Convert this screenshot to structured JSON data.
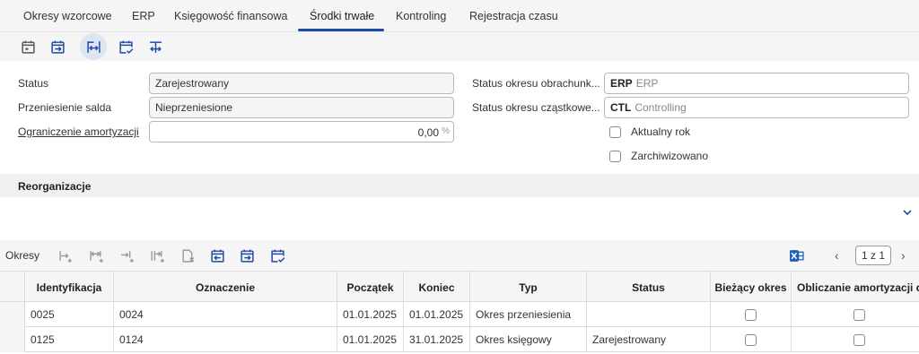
{
  "tabs": [
    "Okresy wzorcowe",
    "ERP",
    "Księgowość finansowa",
    "Środki trwałe",
    "Kontroling",
    "Rejestracja czasu"
  ],
  "active_tab": "Środki trwałe",
  "toolbar": {
    "icons": [
      "calendar-icon",
      "calendar-enter-icon",
      "column-span-icon",
      "calendar-check-icon",
      "transfer-icon"
    ]
  },
  "form": {
    "status_label": "Status",
    "status_value": "Zarejestrowany",
    "balance_transfer_label": "Przeniesienie salda",
    "balance_transfer_value": "Nieprzeniesione",
    "depreciation_limit_label": "Ograniczenie amortyzacji",
    "depreciation_limit_value": "0,00",
    "depreciation_limit_unit": "%",
    "accounting_period_status_label": "Status okresu obrachunk...",
    "accounting_period_status_code": "ERP",
    "accounting_period_status_desc": "ERP",
    "partial_period_status_label": "Status okresu cząstkowe...",
    "partial_period_status_code": "CTL",
    "partial_period_status_desc": "Controlling",
    "current_year_label": "Aktualny rok",
    "current_year_checked": false,
    "archived_label": "Zarchiwizowano",
    "archived_checked": false
  },
  "reorg": {
    "title": "Reorganizacje"
  },
  "periods": {
    "title": "Okresy",
    "pager": "1 z 1",
    "columns": [
      "Identyfikacja",
      "Oznaczenie",
      "Początek",
      "Koniec",
      "Typ",
      "Status",
      "Bieżący okres",
      "Obliczanie amortyzacji do"
    ],
    "rows": [
      {
        "id": "0025",
        "designation": "0024",
        "start": "01.01.2025",
        "end": "01.01.2025",
        "type": "Okres przeniesienia",
        "status": "",
        "current": false,
        "depreciation": false
      },
      {
        "id": "0125",
        "designation": "0124",
        "start": "01.01.2025",
        "end": "31.01.2025",
        "type": "Okres księgowy",
        "status": "Zarejestrowany",
        "current": false,
        "depreciation": false
      }
    ]
  },
  "colors": {
    "accent": "#1f4aa8",
    "excel": "#1d5fb8"
  }
}
